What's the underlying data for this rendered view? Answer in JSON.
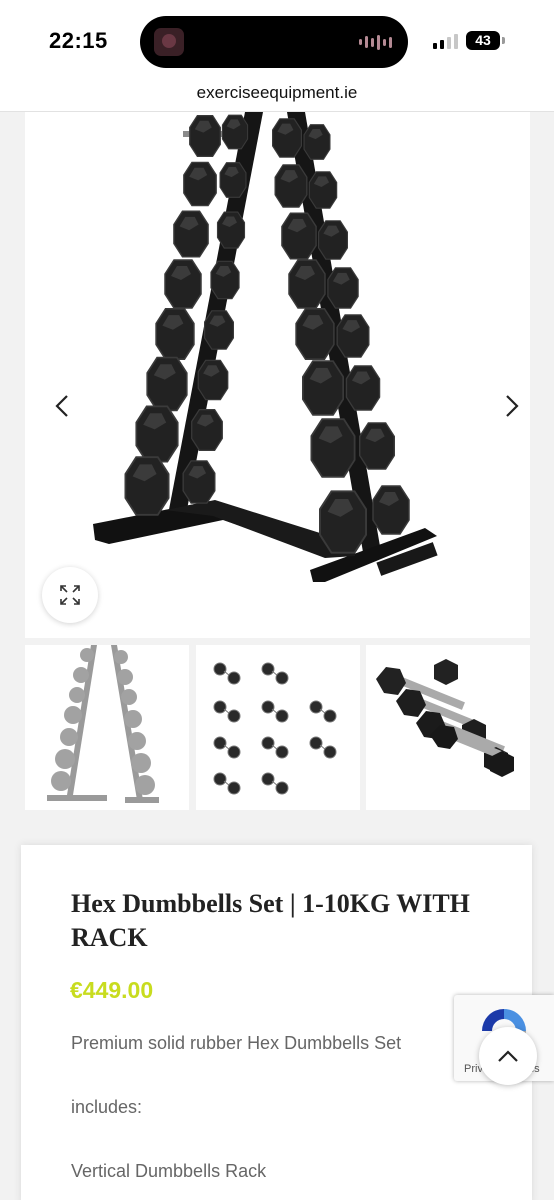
{
  "status_bar": {
    "time": "22:15",
    "battery": "43",
    "icons": [
      "now-playing-icon",
      "audio-waveform-icon",
      "cellular-signal-icon",
      "battery-icon"
    ]
  },
  "browser": {
    "url": "exerciseequipment.ie"
  },
  "gallery": {
    "main_image": "hex-dumbbells-on-vertical-a-frame-rack",
    "thumbnails": [
      "dumbbell-rack-faded-thumbnail",
      "dumbbell-pairs-grid-thumbnail",
      "dumbbell-set-stacked-thumbnail"
    ],
    "icons": [
      "chevron-left-icon",
      "chevron-right-icon",
      "expand-icon"
    ]
  },
  "product": {
    "title": "Hex Dumbbells Set | 1-10KG WITH RACK",
    "price": "€449.00",
    "price_color": "#c8dc1f",
    "description": [
      "Premium solid rubber Hex Dumbbells Set",
      "includes:",
      "Vertical Dumbbells Rack"
    ]
  },
  "recaptcha": {
    "links": "Privacy - Terms"
  },
  "colors": {
    "background": "#f2f2f2",
    "card": "#ffffff",
    "title": "#222222",
    "body_text": "#666666"
  }
}
